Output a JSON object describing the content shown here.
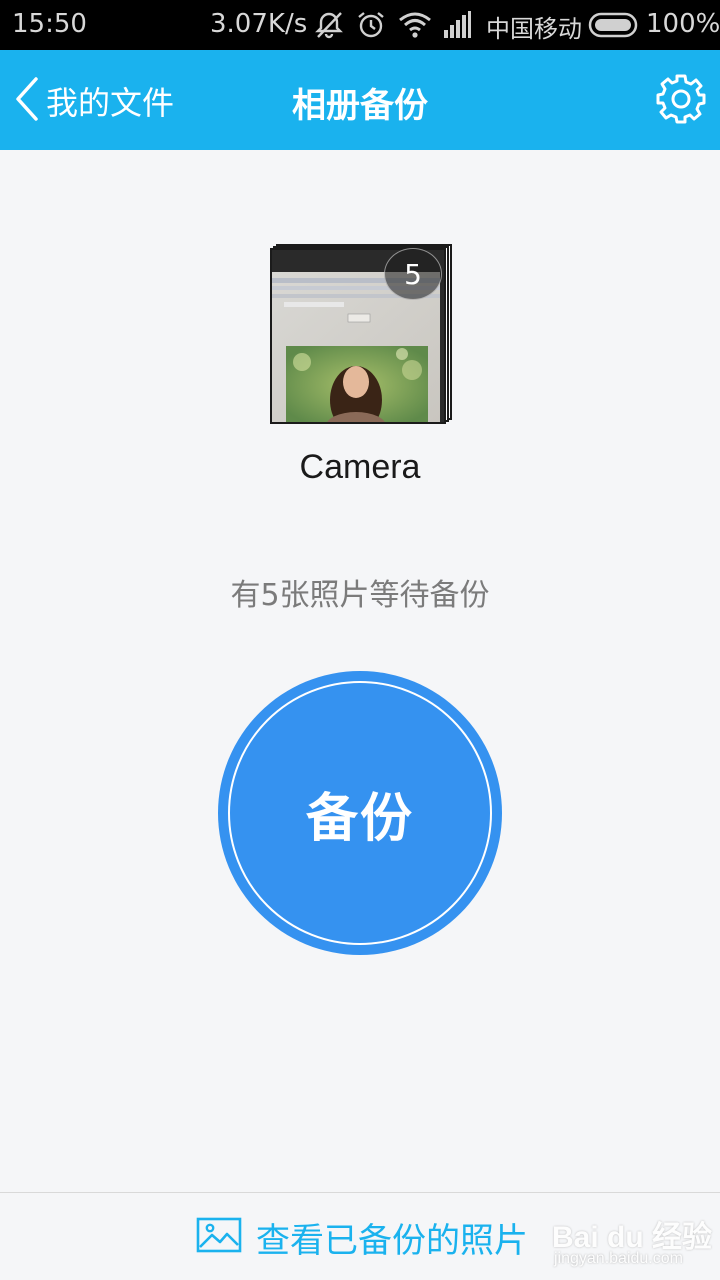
{
  "status_bar": {
    "time": "15:50",
    "speed": "3.07K/s",
    "carrier": "中国移动",
    "battery": "100%",
    "icons": [
      "mute-vibrate-icon",
      "alarm-icon",
      "wifi-icon",
      "signal-icon",
      "battery-icon"
    ]
  },
  "title_bar": {
    "back_label": "我的文件",
    "title": "相册备份",
    "background": "#1ab2ee"
  },
  "album": {
    "name": "Camera",
    "count": "5"
  },
  "pending_text": "有5张照片等待备份",
  "backup_button": {
    "label": "备份",
    "color": "#3592f0"
  },
  "bottom": {
    "view_backed_label": "查看已备份的照片",
    "accent": "#1ab2ee"
  },
  "watermark": {
    "brand": "Bai du 经验",
    "sub": "jingyan.baidu.com"
  }
}
